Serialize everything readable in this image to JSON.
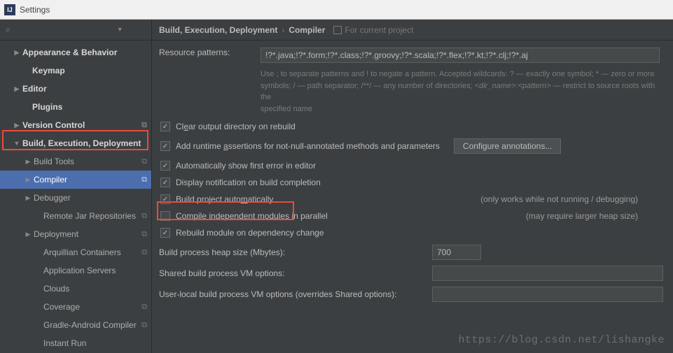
{
  "window": {
    "title": "Settings"
  },
  "search": {
    "placeholder": ""
  },
  "sidebar": {
    "items": [
      {
        "label": "Appearance & Behavior",
        "arrow": "▶",
        "indent": 18,
        "bold": true
      },
      {
        "label": "Keymap",
        "arrow": "",
        "indent": 32,
        "bold": true
      },
      {
        "label": "Editor",
        "arrow": "▶",
        "indent": 18,
        "bold": true
      },
      {
        "label": "Plugins",
        "arrow": "",
        "indent": 32,
        "bold": true
      },
      {
        "label": "Version Control",
        "arrow": "▶",
        "indent": 18,
        "bold": true,
        "copy": true
      },
      {
        "label": "Build, Execution, Deployment",
        "arrow": "▼",
        "indent": 18,
        "bold": true
      },
      {
        "label": "Build Tools",
        "arrow": "▶",
        "indent": 34,
        "copy": true
      },
      {
        "label": "Compiler",
        "arrow": "▶",
        "indent": 34,
        "selected": true,
        "copy": true
      },
      {
        "label": "Debugger",
        "arrow": "▶",
        "indent": 34
      },
      {
        "label": "Remote Jar Repositories",
        "arrow": "",
        "indent": 48,
        "copy": true
      },
      {
        "label": "Deployment",
        "arrow": "▶",
        "indent": 34,
        "copy": true
      },
      {
        "label": "Arquillian Containers",
        "arrow": "",
        "indent": 48,
        "copy": true
      },
      {
        "label": "Application Servers",
        "arrow": "",
        "indent": 48
      },
      {
        "label": "Clouds",
        "arrow": "",
        "indent": 48
      },
      {
        "label": "Coverage",
        "arrow": "",
        "indent": 48,
        "copy": true
      },
      {
        "label": "Gradle-Android Compiler",
        "arrow": "",
        "indent": 48,
        "copy": true
      },
      {
        "label": "Instant Run",
        "arrow": "",
        "indent": 48
      }
    ]
  },
  "breadcrumb": {
    "root": "Build, Execution, Deployment",
    "leaf": "Compiler",
    "scope": "For current project"
  },
  "form": {
    "resource_patterns_label": "Resource patterns:",
    "resource_patterns_value": "!?*.java;!?*.form;!?*.class;!?*.groovy;!?*.scala;!?*.flex;!?*.kt;!?*.clj;!?*.aj",
    "hint_line1": "Use ; to separate patterns and ! to negate a pattern. Accepted wildcards: ? — exactly one symbol; * — zero or more",
    "hint_line2_a": "symbols; / — path separator; /**/ — any number of directories; ",
    "hint_line2_b": "<dir_name>:<pattern>",
    "hint_line2_c": " — restrict to source roots with the",
    "hint_line3": "specified name",
    "checks": [
      {
        "label_pre": "Cl",
        "label_u": "e",
        "label_post": "ar output directory on rebuild",
        "on": true
      },
      {
        "label_pre": "Add runtime ",
        "label_u": "a",
        "label_post": "ssertions for not-null-annotated methods and parameters",
        "on": true,
        "button": "Configure annotations..."
      },
      {
        "label_pre": "Automatically show first error in editor",
        "on": true
      },
      {
        "label_pre": "Display notification on build completion",
        "on": true
      },
      {
        "label_pre": "Build project auto",
        "label_u": "m",
        "label_post": "atically",
        "on": true,
        "note": "(only works while not running / debugging)",
        "boxed": true
      },
      {
        "label_pre": "Compile independent modules in parallel",
        "on": false,
        "note": "(may require larger heap size)"
      },
      {
        "label_pre": "Rebuild module on dependency change",
        "on": true
      }
    ],
    "heap_label": "Build process heap size (Mbytes):",
    "heap_value": "700",
    "shared_vm_label": "Shared build process VM options:",
    "shared_vm_value": "",
    "user_vm_label": "User-local build process VM options (overrides Shared options):",
    "user_vm_value": ""
  },
  "watermark": "https://blog.csdn.net/lishangke"
}
